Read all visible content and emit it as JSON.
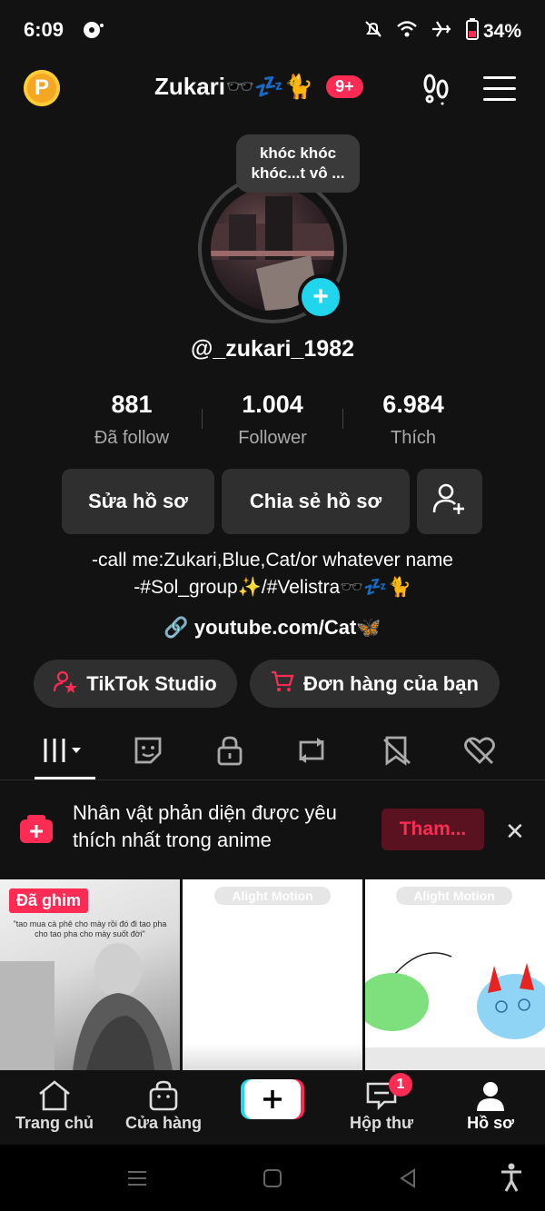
{
  "status_bar": {
    "time": "6:09",
    "battery": "34%"
  },
  "header": {
    "title": "Zukari🕶️💤🐈",
    "badge": "9+",
    "coin_letter": "P"
  },
  "profile": {
    "note": "khóc khóc khóc...t vô ...",
    "username": "@_zukari_1982",
    "stats": [
      {
        "value": "881",
        "label": "Đã follow"
      },
      {
        "value": "1.004",
        "label": "Follower"
      },
      {
        "value": "6.984",
        "label": "Thích"
      }
    ],
    "buttons": {
      "edit": "Sửa hồ sơ",
      "share": "Chia sẻ hồ sơ"
    },
    "bio_line1": "-call me:Zukari,Blue,Cat/or whatever name",
    "bio_line2": "-#Sol_group✨/#Velistra🕶️💤🐈",
    "link": "youtube.com/Cat🦋",
    "pills": {
      "studio": "TikTok Studio",
      "orders": "Đơn hàng của bạn"
    }
  },
  "tabs": [
    "videos-icon",
    "sticker-icon",
    "lock-icon",
    "repost-icon",
    "saved-icon",
    "liked-icon"
  ],
  "banner": {
    "text": "Nhân vật phản diện được yêu thích nhất trong anime",
    "button": "Tham..."
  },
  "grid": {
    "pinned": "Đã ghim",
    "caption": "\"tao mua cà phê cho mày rồi đó đi tao pha cho tao pha cho mày suốt đời\"",
    "watermark": "Alight Motion"
  },
  "bottom_nav": [
    {
      "label": "Trang chủ"
    },
    {
      "label": "Cửa hàng"
    },
    {
      "label": ""
    },
    {
      "label": "Hộp thư",
      "badge": "1"
    },
    {
      "label": "Hồ sơ"
    }
  ],
  "colors": {
    "accent": "#fe2c55",
    "cyan": "#20d5ec",
    "bg": "#121212"
  }
}
